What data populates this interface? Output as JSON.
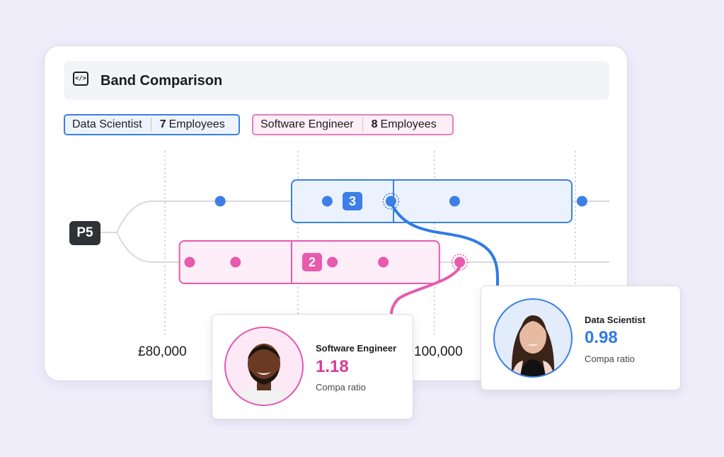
{
  "header": {
    "icon": "code-icon",
    "icon_glyph": "</>",
    "title": "Band Comparison"
  },
  "legend": [
    {
      "role": "Data Scientist",
      "count": "7",
      "count_label": "Employees",
      "color": "#3d7fe6"
    },
    {
      "role": "Software Engineer",
      "count": "8",
      "count_label": "Employees",
      "color": "#e75aae"
    }
  ],
  "level_badge": "P5",
  "axis": {
    "labels": [
      "£80,000",
      "100,000"
    ]
  },
  "chart_data": {
    "type": "scatter",
    "title": "Band Comparison",
    "group": "P5",
    "x_ticks": [
      "£80,000",
      "100,000"
    ],
    "series": [
      {
        "name": "Data Scientist",
        "employees": 7,
        "color": "#3d7fe6",
        "band": {
          "min": 0.35,
          "mid": 0.55,
          "max": 0.9
        },
        "clustered_count": 3,
        "points": [
          0.21,
          0.42,
          0.545,
          0.67,
          0.92
        ],
        "highlighted_point": 0.545
      },
      {
        "name": "Software Engineer",
        "employees": 8,
        "color": "#e75aae",
        "band": {
          "min": 0.13,
          "mid": 0.35,
          "max": 0.64
        },
        "clustered_count": 2,
        "points": [
          0.15,
          0.24,
          0.43,
          0.53
        ],
        "outside_points": [
          0.68
        ],
        "highlighted_point": 0.68
      }
    ],
    "grid": "vertical-dotted"
  },
  "badges": {
    "ds_count": "3",
    "se_count": "2"
  },
  "cards": {
    "software_engineer": {
      "role": "Software Engineer",
      "value": "1.18",
      "label": "Compa ratio",
      "avatar": "person-photo"
    },
    "data_scientist": {
      "role": "Data Scientist",
      "value": "0.98",
      "label": "Compa ratio",
      "avatar": "person-photo"
    }
  }
}
